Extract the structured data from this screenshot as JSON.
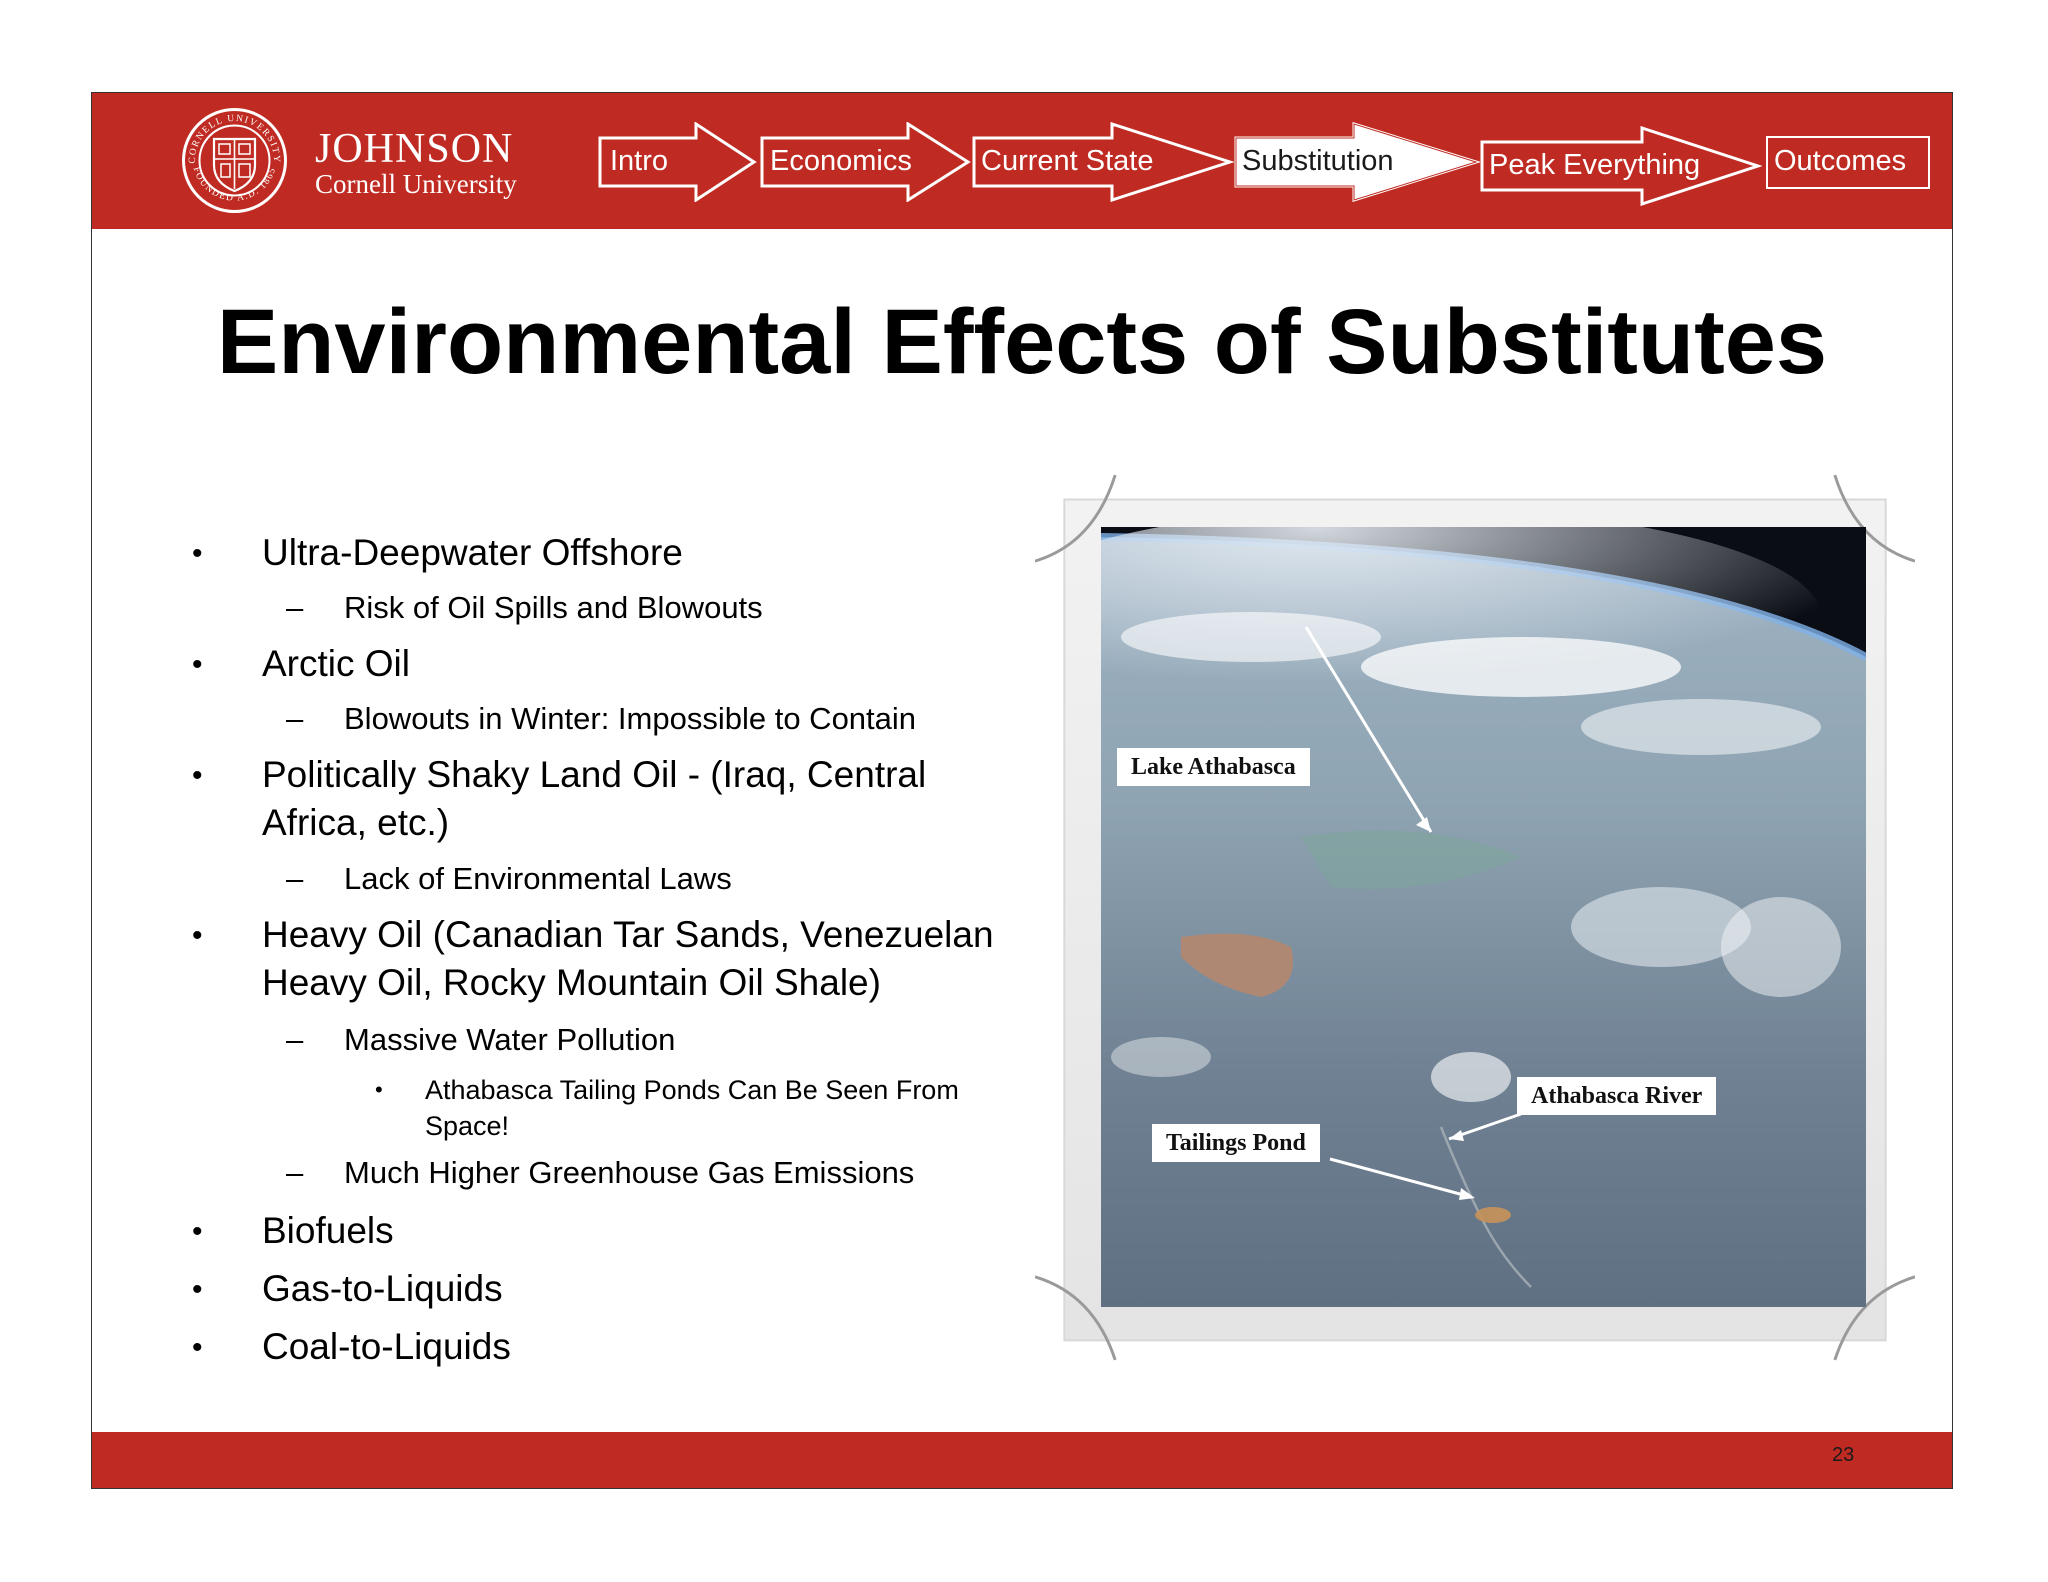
{
  "header": {
    "seal_text": "CORNELL UNIVERSITY FOUNDED A.D. 1865",
    "brand_name": "JOHNSON",
    "brand_sub": "Cornell University",
    "nav": [
      {
        "label": "Intro"
      },
      {
        "label": "Economics"
      },
      {
        "label": "Current State"
      },
      {
        "label": "Substitution"
      },
      {
        "label": "Peak Everything"
      },
      {
        "label": "Outcomes"
      }
    ]
  },
  "title": "Environmental Effects of Substitutes",
  "bullets": [
    {
      "level": 1,
      "text": "Ultra-Deepwater Offshore"
    },
    {
      "level": 2,
      "text": "Risk of Oil Spills and Blowouts"
    },
    {
      "level": 1,
      "text": "Arctic Oil"
    },
    {
      "level": 2,
      "text": "Blowouts in Winter: Impossible to Contain"
    },
    {
      "level": 1,
      "text": "Politically Shaky Land Oil - (Iraq, Central",
      "cont": "Africa, etc.)"
    },
    {
      "level": 2,
      "text": "Lack of Environmental Laws"
    },
    {
      "level": 1,
      "text": "Heavy Oil (Canadian Tar Sands, Venezuelan",
      "cont": "Heavy Oil, Rocky Mountain Oil Shale)"
    },
    {
      "level": 2,
      "text": "Massive Water Pollution"
    },
    {
      "level": 3,
      "text": "Athabasca Tailing Ponds Can Be Seen From",
      "cont": "Space!"
    },
    {
      "level": 2,
      "text": "Much Higher Greenhouse Gas Emissions"
    },
    {
      "level": 1,
      "text": "Biofuels"
    },
    {
      "level": 1,
      "text": "Gas-to-Liquids"
    },
    {
      "level": 1,
      "text": "Coal-to-Liquids"
    }
  ],
  "photo": {
    "labels": {
      "lake": "Lake Athabasca",
      "river": "Athabasca River",
      "pond": "Tailings Pond"
    }
  },
  "page_number": "23",
  "colors": {
    "brand_red": "#bf2b22",
    "nav_active_fill": "#ffffff",
    "nav_text": "#ffffff"
  }
}
